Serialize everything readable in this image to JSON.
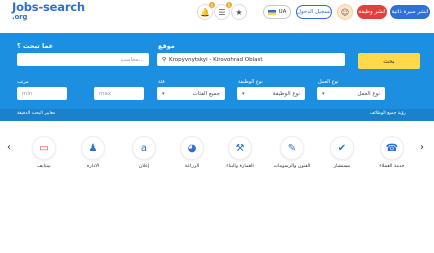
{
  "header": {
    "logo_main": "Jobs-search",
    "logo_sub": ".org",
    "post_job_label": "انشر وظيفة",
    "post_cv_label": "انشر سيرة ذاتية",
    "login_label": "تسجيل الدخول",
    "lang_label": "UA",
    "notif_count": "0",
    "list_count": "0",
    "avatar_icon": "user-avatar",
    "bell_icon": "bell-icon",
    "list_icon": "list-icon",
    "star_icon": "star-icon"
  },
  "search": {
    "what_label": "عما تبحث ؟",
    "what_placeholder": "محاسب...",
    "where_label": "موقع",
    "where_value": "Kropyvnytskyi - Kirovohrad Oblast",
    "search_button": "بحث",
    "salary_label": "مرتب",
    "min_placeholder": "min",
    "max_placeholder": "max",
    "category_label": "فئة",
    "category_value": "جميع الفئات",
    "jobtype_label": "نوع الوظيفة",
    "jobtype_value": "نوع الوظيفة",
    "worktype_label": "نوع العمل",
    "worktype_value": "نوع العمل",
    "advanced_link": "معايير البحث الدقيقة",
    "all_jobs_link": "رؤية جميع الوظائف"
  },
  "categories": [
    {
      "name": "خدمة العملاء",
      "icon": "phone-icon",
      "glyph": "☎"
    },
    {
      "name": "مستشار",
      "icon": "check-icon",
      "glyph": "✔"
    },
    {
      "name": "الفنون والرسومات",
      "icon": "brush-icon",
      "glyph": "✎"
    },
    {
      "name": "العمارة والبناء",
      "icon": "wrench-icon",
      "glyph": "⚒"
    },
    {
      "name": "الزراعة",
      "icon": "pie-chart-icon",
      "glyph": "◕"
    },
    {
      "name": "إعلان",
      "icon": "amazon-icon",
      "glyph": "a"
    },
    {
      "name": "الادارة",
      "icon": "users-icon",
      "glyph": "♟"
    },
    {
      "name": "بيتنايف",
      "icon": "cash-icon",
      "glyph": "▭"
    }
  ],
  "colors": {
    "band": "#1d8fe1",
    "accent": "#2f6fd6",
    "search_button": "#ffd94a"
  }
}
